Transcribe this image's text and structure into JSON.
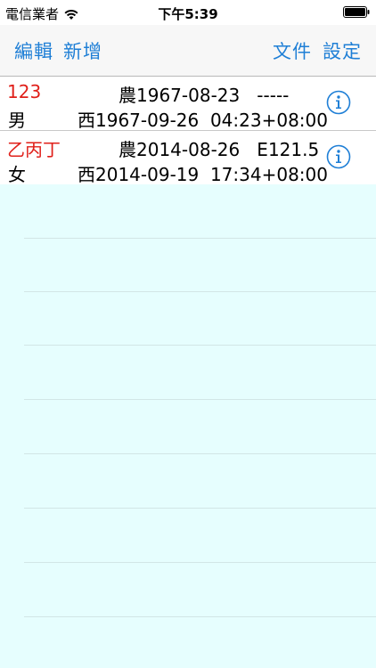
{
  "status_bar": {
    "carrier": "電信業者",
    "time": "下午5:39"
  },
  "nav": {
    "edit_label": "編輯",
    "add_label": "新增",
    "file_label": "文件",
    "settings_label": "設定"
  },
  "records": [
    {
      "name": "123",
      "gender": "男",
      "lunar": "農1967-08-23   -----",
      "solar": "西1967-09-26  04:23+08:00"
    },
    {
      "name": "乙丙丁",
      "gender": "女",
      "lunar": "農2014-08-26   E121.5",
      "solar": "西2014-09-19  17:34+08:00"
    }
  ],
  "colors": {
    "accent": "#1f7fd6",
    "name_text": "#e0201a",
    "empty_background": "#e6fefe"
  },
  "icons": {
    "wifi": "wifi-icon",
    "battery": "battery-icon",
    "info": "info-icon"
  }
}
